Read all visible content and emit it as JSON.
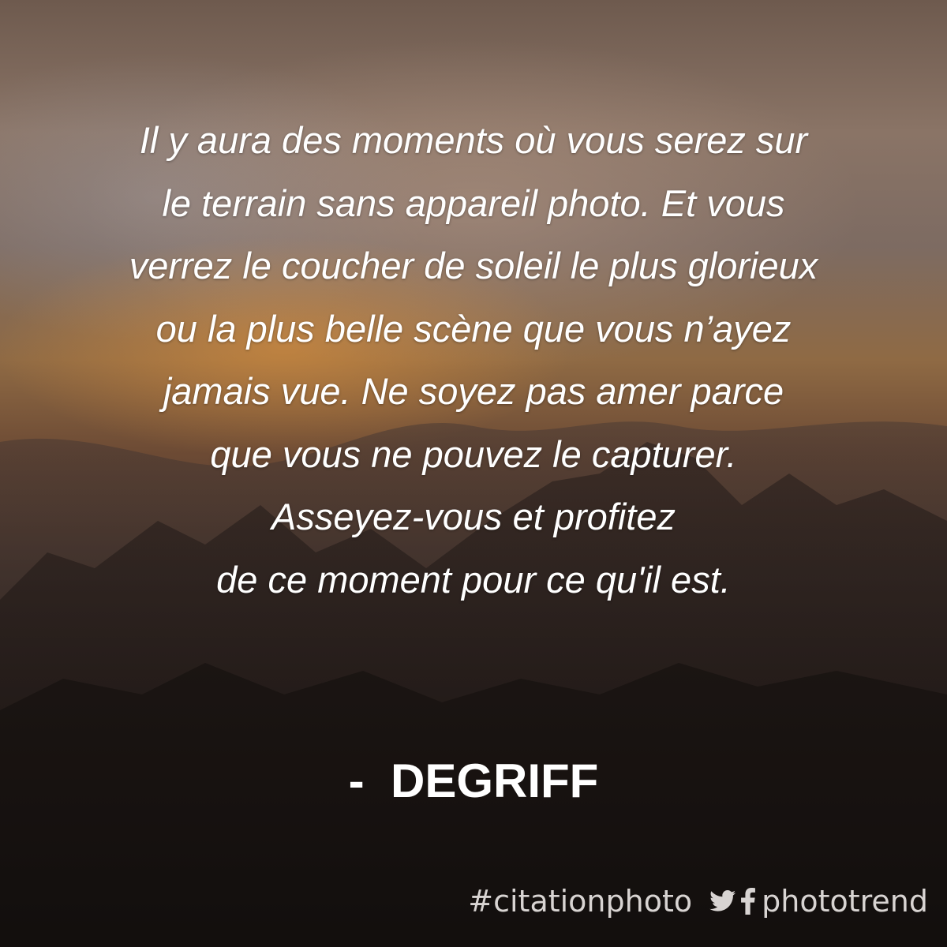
{
  "quote": {
    "lines": [
      "Il y aura des moments où vous serez sur",
      "le terrain sans appareil photo. Et vous",
      "verrez le coucher de soleil le plus glorieux",
      "ou la plus belle scène que vous n’ayez",
      "jamais vue. Ne soyez pas amer parce",
      "que vous ne pouvez le capturer.",
      "Asseyez-vous et profitez",
      "de ce moment pour ce qu'il est."
    ]
  },
  "author": "-  DEGRIFF",
  "footer": {
    "hashtag": "#citationphoto",
    "handle": "phototrend",
    "icons": [
      "twitter-icon",
      "facebook-icon"
    ]
  },
  "colors": {
    "text": "#ffffff",
    "footer_text": "#d8d4d2"
  }
}
